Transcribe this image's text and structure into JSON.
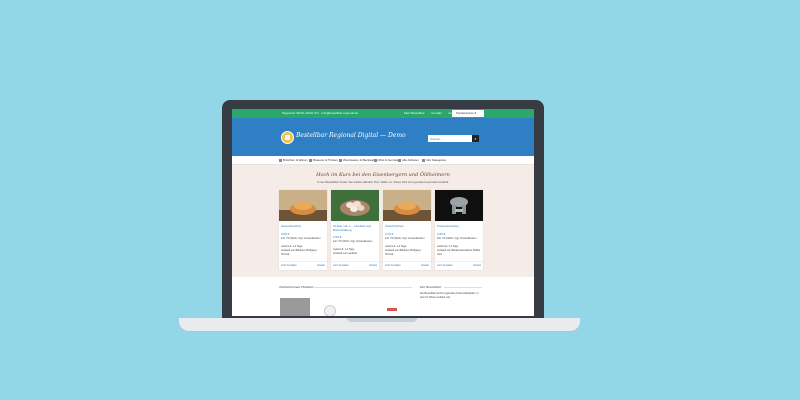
{
  "topbar": {
    "info": "Tageszeit: 08:00–18:00 Uhr · info@bestellbar-regional.de",
    "links": [
      "Mein Bestellbar",
      "Kontakt",
      "Anmelden"
    ],
    "account_label": "Kundenkonto"
  },
  "header": {
    "site_title": "Bestellbar Regional Digital — Demo",
    "search_placeholder": "Suchen...",
    "search_icon": "search-icon"
  },
  "nav": {
    "items": [
      "Brötchen & Waren",
      "Brauerei & Trinken",
      "Wurstwaren & Backwaren",
      "Obst & Gemüse",
      "Alle Anbieter",
      "Info Kategorien"
    ]
  },
  "hero": {
    "title": "Hoch im Kurs bei den Eisenbergern und Ölilheimern",
    "subtitle": "In der Bestellbar finden Sie lokale Händler Ihrer Nähe zu. Diese fünf sind gerade besonders beliebt."
  },
  "products": [
    {
      "name": "Hasenbrötchen",
      "price": "0,59 €",
      "meta": [
        "inkl. 7% MwSt. zzgl. Versandkosten",
        "Lieferzeit: 1-2 Tage",
        "Verkauft von Bäckerei Wolfgang Schmitt"
      ],
      "action_left": "Jetzt bestellen",
      "action_right": "Details"
    },
    {
      "name": "10 Eier von L... Landwirt aus Bodenhaltung",
      "price": "2,50 €",
      "meta": [
        "inkl. 7% MwSt. zzgl. Versandkosten",
        "Lieferzeit: 1-2 Tage",
        "Verkauft von Landwirt"
      ],
      "action_left": "Jetzt bestellen",
      "action_right": "Details"
    },
    {
      "name": "Osterbrötchen",
      "price": "0,79 €",
      "meta": [
        "inkl. 7% MwSt. zzgl. Versandkosten",
        "Lieferzeit: 1-2 Tage",
        "Verkauft von Bäckerei Wolfgang Schmitt"
      ],
      "action_left": "Jetzt bestellen",
      "action_right": "Details"
    },
    {
      "name": "Ostereierkuchen",
      "price": "0,95 €",
      "meta": [
        "inkl. 7% MwSt. zzgl. Versandkosten",
        "Lieferzeit: 1-2 Tage",
        "Verkauft von Bäckereikonditorei Willkür Gert"
      ],
      "action_left": "Jetzt bestellen",
      "action_right": "Details"
    }
  ],
  "bottom": {
    "left_heading": "Teilnehmende Händler",
    "right_heading": "Die Bestellbar",
    "right_text": "Die Bestellbar ist Ihre regionale Online-Marktplatz, in dem Ihr Waren einfach und"
  },
  "colors": {
    "background": "#92d6e7",
    "topbar": "#2aa76a",
    "header": "#2f7fc5",
    "hero": "#f5ece7"
  }
}
